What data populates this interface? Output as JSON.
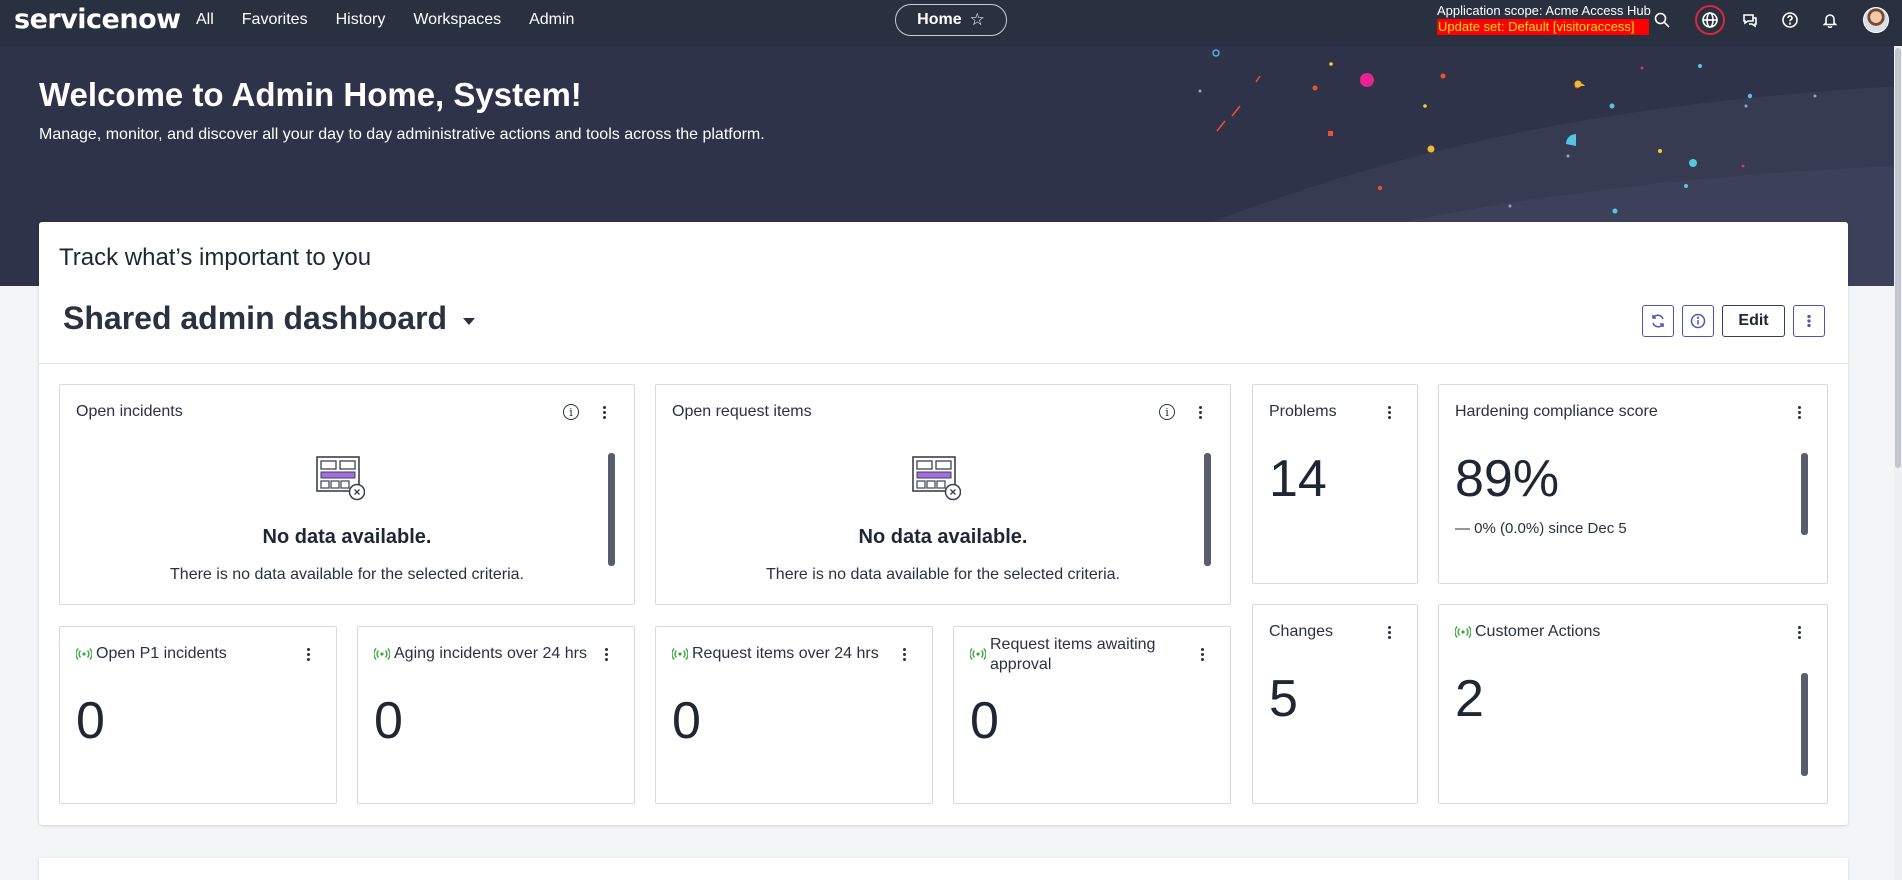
{
  "nav": {
    "logo_text": "servicenow",
    "links": [
      "All",
      "Favorites",
      "History",
      "Workspaces",
      "Admin"
    ],
    "home_label": "Home",
    "scope_line": "Application scope: Acme Access Hub",
    "update_set": "Update set: Default [visitoraccess]",
    "icons": [
      "search-icon",
      "globe-icon",
      "chat-icon",
      "help-icon",
      "bell-icon",
      "avatar"
    ]
  },
  "hero": {
    "title": "Welcome to Admin Home, System!",
    "subtitle": "Manage, monitor, and discover all your day to day administrative actions and tools across the platform."
  },
  "dashboard": {
    "section_title": "Track what’s important to you",
    "name": "Shared admin dashboard",
    "edit_label": "Edit"
  },
  "widgets": {
    "open_incidents": {
      "title": "Open incidents",
      "empty_heading": "No data available.",
      "empty_text": "There is no data available for the selected criteria."
    },
    "open_request_items": {
      "title": "Open request items",
      "empty_heading": "No data available.",
      "empty_text": "There is no data available for the selected criteria."
    },
    "problems": {
      "title": "Problems",
      "value": "14"
    },
    "hardening": {
      "title": "Hardening compliance score",
      "value": "89%",
      "delta": "0% (0.0%) since Dec 5"
    },
    "open_p1": {
      "title": "Open P1 incidents",
      "value": "0"
    },
    "aging": {
      "title": "Aging incidents over 24 hrs",
      "value": "0"
    },
    "req_24": {
      "title": "Request items over 24 hrs",
      "value": "0"
    },
    "req_awaiting": {
      "title_line1": "Request items awaiting",
      "title_line2": "approval",
      "value": "0"
    },
    "changes": {
      "title": "Changes",
      "value": "5"
    },
    "customer_actions": {
      "title": "Customer Actions",
      "value": "2"
    }
  },
  "colors": {
    "nav_bg": "#293040",
    "hero_bg": "#2f3349",
    "accent": "#4f56a8",
    "live_green": "#3eaa3a",
    "update_set_bg": "#ff0000",
    "update_set_text": "#ffe600"
  }
}
